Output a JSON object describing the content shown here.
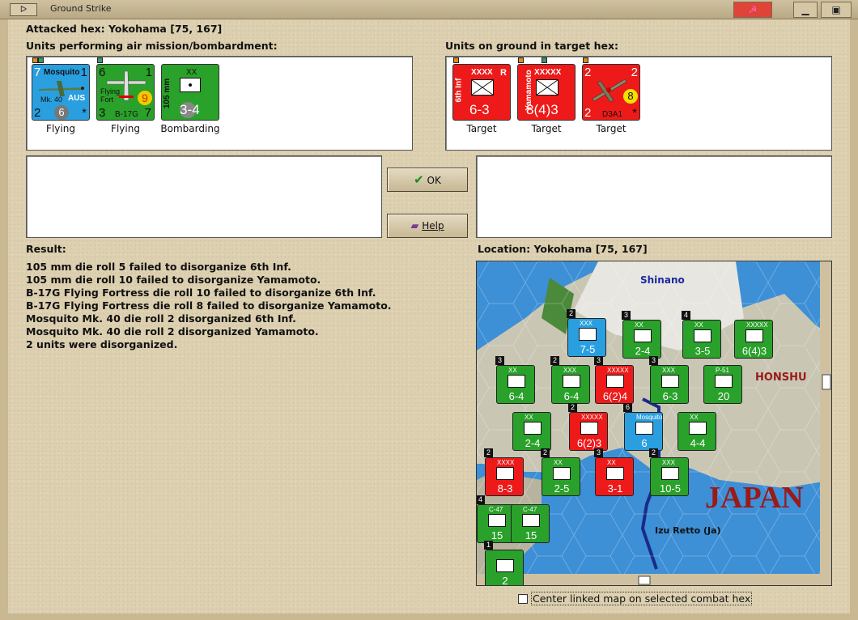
{
  "window": {
    "title": "Ground Strike",
    "system_menu_label": "ᐅ",
    "minimize_label": "▁",
    "close_label": "☭",
    "extra_label": "▣"
  },
  "attacked_hex": "Attacked hex: Yokohama  [75, 167]",
  "air_units_label": "Units performing air mission/bombardment:",
  "ground_units_label": "Units on ground in target hex:",
  "air_units": [
    {
      "top_left": "7",
      "top_right": "1",
      "name": "Mosquito",
      "sub": "Mk. 40",
      "nation": "AUS",
      "bottom_left": "2",
      "bottom_center": "6",
      "bottom_right": "*",
      "caption": "Flying",
      "color": "#2a9fe0"
    },
    {
      "top_left": "6",
      "top_right": "1",
      "name": "Flying Fort",
      "sub": "B-17G",
      "badge": "9",
      "bottom_left": "3",
      "bottom_right": "7",
      "caption": "Flying",
      "color": "#2aa12a"
    },
    {
      "size": "XX",
      "name": "105 mm",
      "strength": "3-4",
      "caption": "Bombarding",
      "color": "#2aa12a"
    }
  ],
  "ground_units": [
    {
      "size": "XXXX",
      "corner": "R",
      "name": "6th Inf",
      "strength": "6-3",
      "caption": "Target",
      "color": "#ee1a1a"
    },
    {
      "size": "XXXXX",
      "name": "Yamamoto",
      "strength": "8(4)3",
      "caption": "Target",
      "color": "#ee1a1a"
    },
    {
      "top_left": "2",
      "top_right": "2",
      "badge": "8",
      "name": "D3A1",
      "bottom_left": "2",
      "bottom_right": "*",
      "caption": "Target",
      "color": "#ee1a1a"
    }
  ],
  "buttons": {
    "ok": "OK",
    "help": "Help"
  },
  "result_label": "Result:",
  "results": [
    "105 mm die roll 5 failed to disorganize 6th Inf.",
    "105 mm die roll 10 failed to disorganize Yamamoto.",
    "B-17G Flying Fortress die roll 10 failed to disorganize 6th Inf.",
    "B-17G Flying Fortress die roll 8 failed to disorganize Yamamoto.",
    "Mosquito Mk. 40 die roll 2 disorganized 6th Inf.",
    "Mosquito Mk. 40 die roll 2 disorganized Yamamoto.",
    "2 units were disorganized."
  ],
  "location_label": "Location:  Yokohama  [75, 167]",
  "map": {
    "labels": {
      "shinano": "Shinano",
      "honshu": "HONSHU",
      "japan": "JAPAN",
      "izu": "Izu Retto (Ja)"
    },
    "counters": [
      {
        "color": "#2a9fe0",
        "stack": "2",
        "value": "7-5",
        "size": "XXX"
      },
      {
        "color": "#2aa12a",
        "stack": "3",
        "value": "2-4",
        "size": "XX"
      },
      {
        "color": "#2aa12a",
        "stack": "4",
        "value": "3-5",
        "size": "XX"
      },
      {
        "color": "#2aa12a",
        "stack": "",
        "value": "6(4)3",
        "size": "XXXXX"
      },
      {
        "color": "#2aa12a",
        "stack": "3",
        "value": "6-4",
        "size": "XX"
      },
      {
        "color": "#2aa12a",
        "stack": "2",
        "value": "6-4",
        "size": "XXX"
      },
      {
        "color": "#ee1a1a",
        "stack": "3",
        "value": "6(2)4",
        "size": "XXXXX"
      },
      {
        "color": "#2aa12a",
        "stack": "3",
        "value": "6-3",
        "size": "XXX"
      },
      {
        "color": "#2aa12a",
        "stack": "",
        "value": "20",
        "size": "P-51"
      },
      {
        "color": "#2aa12a",
        "stack": "",
        "value": "2-4",
        "size": "XX"
      },
      {
        "color": "#ee1a1a",
        "stack": "2",
        "value": "6(2)3",
        "size": "XXXXX"
      },
      {
        "color": "#2a9fe0",
        "stack": "6",
        "value": "6",
        "size": "Mosquito"
      },
      {
        "color": "#2aa12a",
        "stack": "",
        "value": "4-4",
        "size": "XX"
      },
      {
        "color": "#ee1a1a",
        "stack": "2",
        "value": "8-3",
        "size": "XXXX"
      },
      {
        "color": "#2aa12a",
        "stack": "2",
        "value": "2-5",
        "size": "XX"
      },
      {
        "color": "#ee1a1a",
        "stack": "3",
        "value": "3-1",
        "size": "XX"
      },
      {
        "color": "#2aa12a",
        "stack": "2",
        "value": "10-5",
        "size": "XXX"
      },
      {
        "color": "#2aa12a",
        "stack": "4",
        "value": "15",
        "size": "C-47"
      },
      {
        "color": "#2aa12a",
        "stack": "",
        "value": "15",
        "size": "C-47"
      },
      {
        "color": "#2aa12a",
        "stack": "1",
        "value": "2",
        "size": ""
      }
    ]
  },
  "checkbox_label": "Center linked map on selected combat hex"
}
